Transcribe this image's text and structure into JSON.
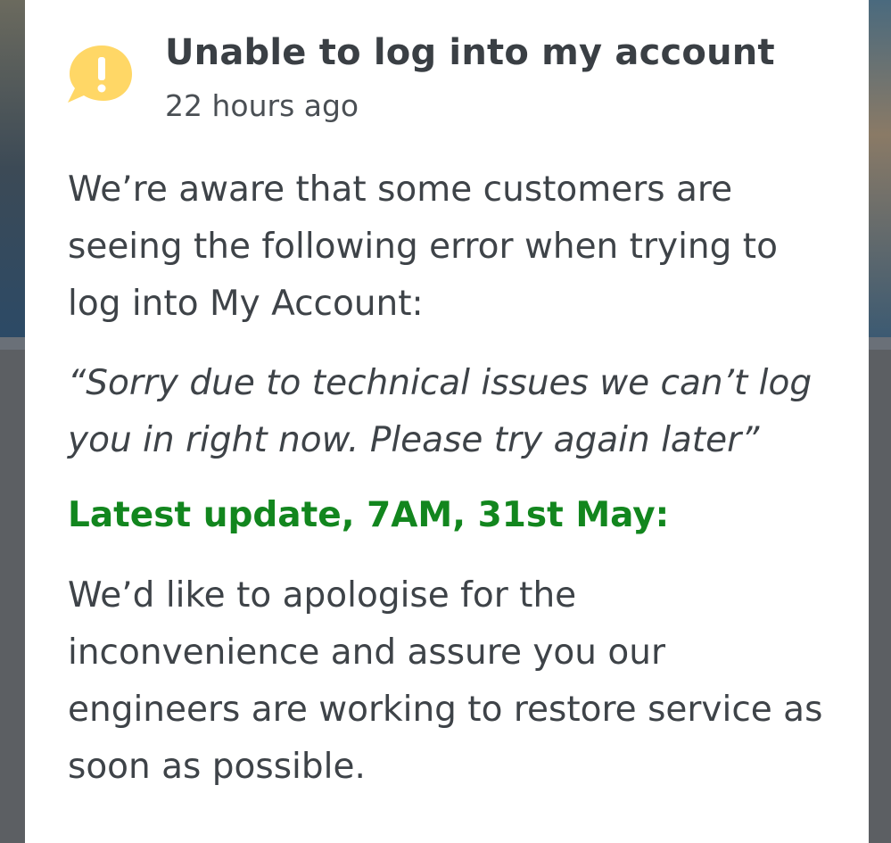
{
  "notice": {
    "icon": "alert-speech-bubble-icon",
    "icon_color": "#FFD766",
    "title": "Unable to log into my account",
    "timestamp": "22 hours ago",
    "intro": "We’re aware that some customers are seeing the following error when trying to log into My Account:",
    "error_quote": "“Sorry due to technical issues we can’t log you in right now. Please try again later”",
    "update_heading": "Latest update, 7AM, 31st May:",
    "update_heading_color": "#12861E",
    "update_body": "We’d like to apologise for the inconvenience and assure you our engineers are working to restore service as soon as possible."
  }
}
